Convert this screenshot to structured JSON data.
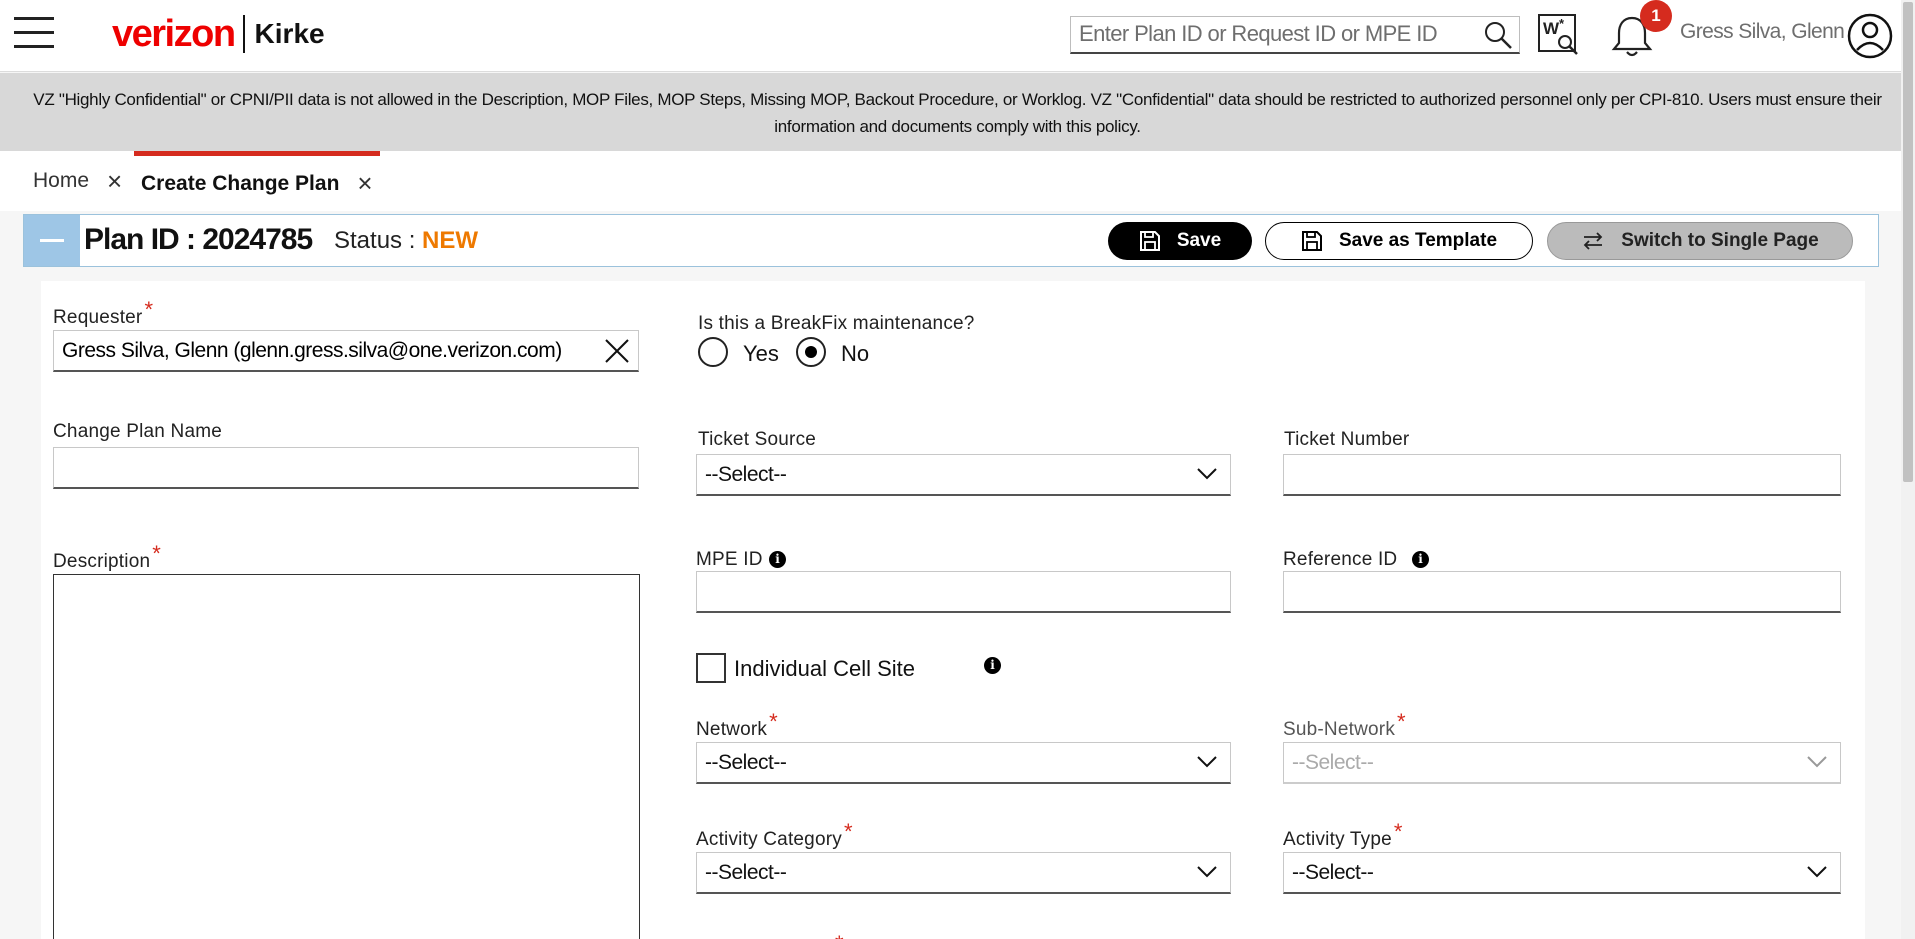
{
  "header": {
    "logo_brand": "verizon",
    "logo_product": "Kirke",
    "search_placeholder": "Enter Plan ID or Request ID or MPE ID",
    "notification_count": "1",
    "user_name": "Gress Silva, Glenn"
  },
  "banner": {
    "text": "VZ \"Highly Confidential\" or CPNI/PII data is not allowed in the Description, MOP Files, MOP Steps, Missing MOP, Backout Procedure, or Worklog. VZ \"Confidential\" data should be restricted to authorized personnel only per CPI-810. Users must ensure their information and documents comply with this policy."
  },
  "tabs": [
    {
      "label": "Home"
    },
    {
      "label": "Create Change Plan"
    }
  ],
  "plan": {
    "id_label": "Plan ID : 2024785",
    "status_label": "Status : ",
    "status_value": "NEW",
    "save_label": "Save",
    "template_label": "Save as Template",
    "switch_label": "Switch to Single Page"
  },
  "form": {
    "requester_label": "Requester",
    "requester_value": "Gress Silva, Glenn (glenn.gress.silva@one.verizon.com)",
    "breakfix_label": "Is this a BreakFix maintenance?",
    "yes_label": "Yes",
    "no_label": "No",
    "change_plan_name_label": "Change Plan Name",
    "ticket_source_label": "Ticket Source",
    "ticket_source_value": "--Select--",
    "ticket_number_label": "Ticket Number",
    "description_label": "Description",
    "mpe_id_label": "MPE ID",
    "reference_id_label": "Reference ID",
    "individual_cell_site_label": "Individual Cell Site",
    "network_label": "Network",
    "network_value": "--Select--",
    "sub_network_label": "Sub-Network",
    "sub_network_value": "--Select--",
    "activity_category_label": "Activity Category",
    "activity_category_value": "--Select--",
    "activity_type_label": "Activity Type",
    "activity_type_value": "--Select--",
    "required_mark": "*",
    "info_glyph": "i"
  }
}
